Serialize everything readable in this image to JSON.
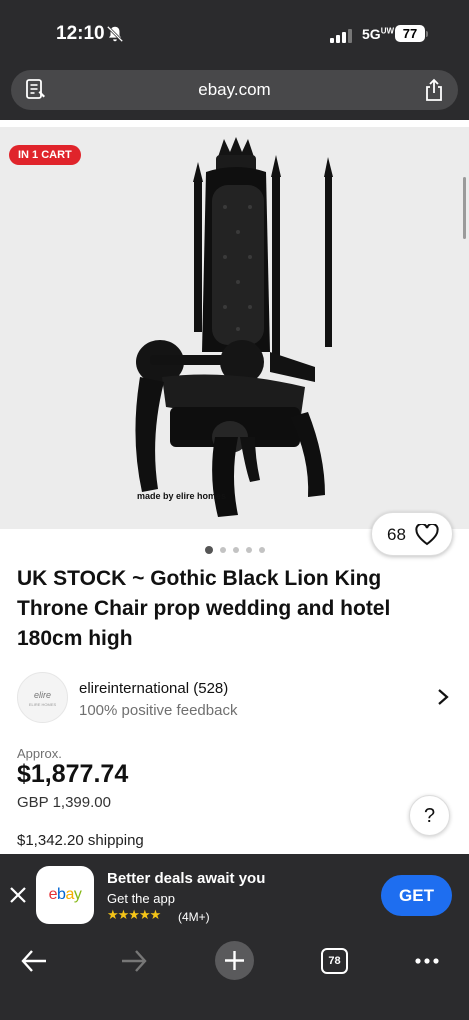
{
  "status_bar": {
    "time": "12:10",
    "network": "5G",
    "battery": "77"
  },
  "browser": {
    "url": "ebay.com",
    "tab_count": "78"
  },
  "listing": {
    "badge": "IN 1 CART",
    "watermark": "made by elire homes",
    "likes": "68",
    "image_count": 5,
    "active_image": 1,
    "title": "UK STOCK ~ Gothic Black Lion King Throne Chair prop wedding and hotel 180cm high",
    "seller": {
      "logo_text": "elire",
      "logo_subtext": "ELIRE HOMES",
      "name": "elireinternational (528)",
      "feedback": "100% positive feedback"
    },
    "approx_label": "Approx.",
    "price": "$1,877.74",
    "original_price": "GBP 1,399.00",
    "shipping": "$1,342.20 shipping",
    "help_label": "?"
  },
  "app_banner": {
    "logo_letters": [
      "e",
      "b",
      "a",
      "y"
    ],
    "logo_colors": [
      "#e53238",
      "#0064d2",
      "#f5af02",
      "#86b817"
    ],
    "headline": "Better deals await you",
    "subtext": "Get the app",
    "stars": "★★★★★",
    "reviews": "(4M+)",
    "get_label": "GET"
  },
  "colors": {
    "badge_red": "#e0242b",
    "get_blue": "#1e6ef0",
    "dark_chrome": "#2b2b2d"
  }
}
